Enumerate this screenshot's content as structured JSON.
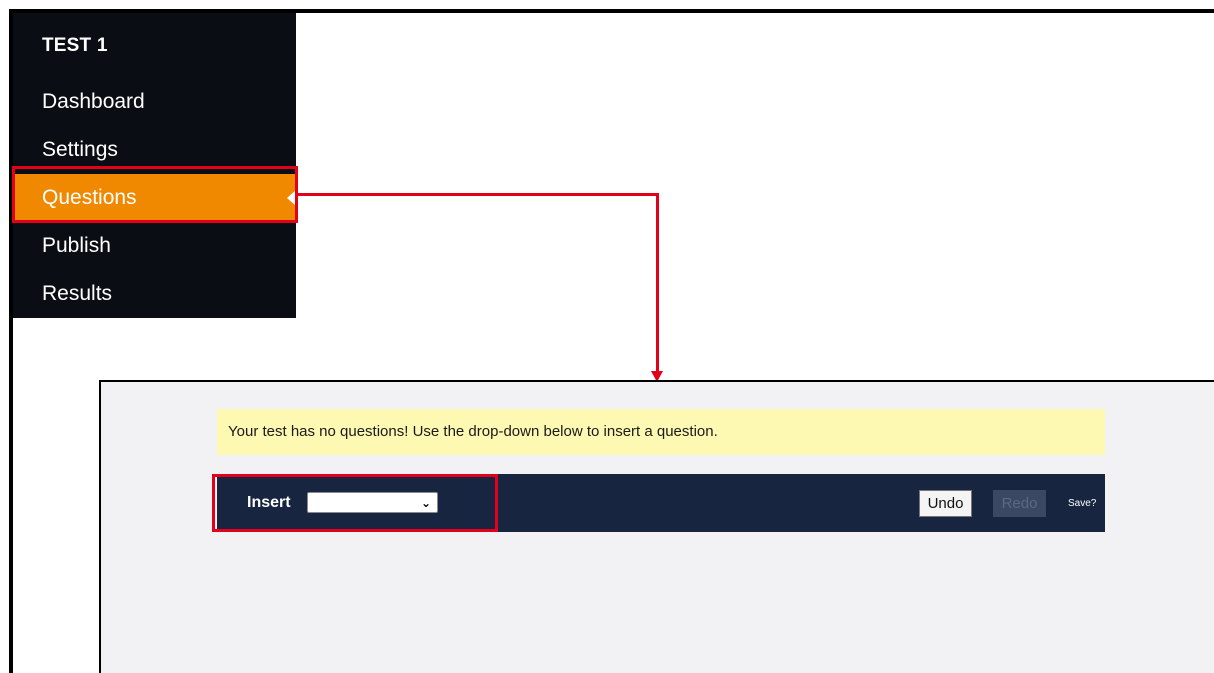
{
  "sidebar": {
    "title": "TEST 1",
    "items": [
      {
        "label": "Dashboard"
      },
      {
        "label": "Settings"
      },
      {
        "label": "Questions",
        "active": true
      },
      {
        "label": "Publish"
      },
      {
        "label": "Results"
      }
    ]
  },
  "editor": {
    "notice": "Your test has no questions! Use the drop-down below to insert a question.",
    "toolbar": {
      "insert_label": "Insert",
      "insert_selected": "",
      "undo_label": "Undo",
      "redo_label": "Redo",
      "save_label": "Save?"
    }
  },
  "colors": {
    "sidebar_bg": "#0b0d14",
    "active_item": "#f08800",
    "highlight": "#e3001b",
    "notice_bg": "#fdf9b3",
    "toolbar_bg": "#172540",
    "panel_bg": "#f2f2f4"
  },
  "icons": {
    "active_caret": "caret-left-icon",
    "select_chevron": "chevron-down-icon"
  }
}
